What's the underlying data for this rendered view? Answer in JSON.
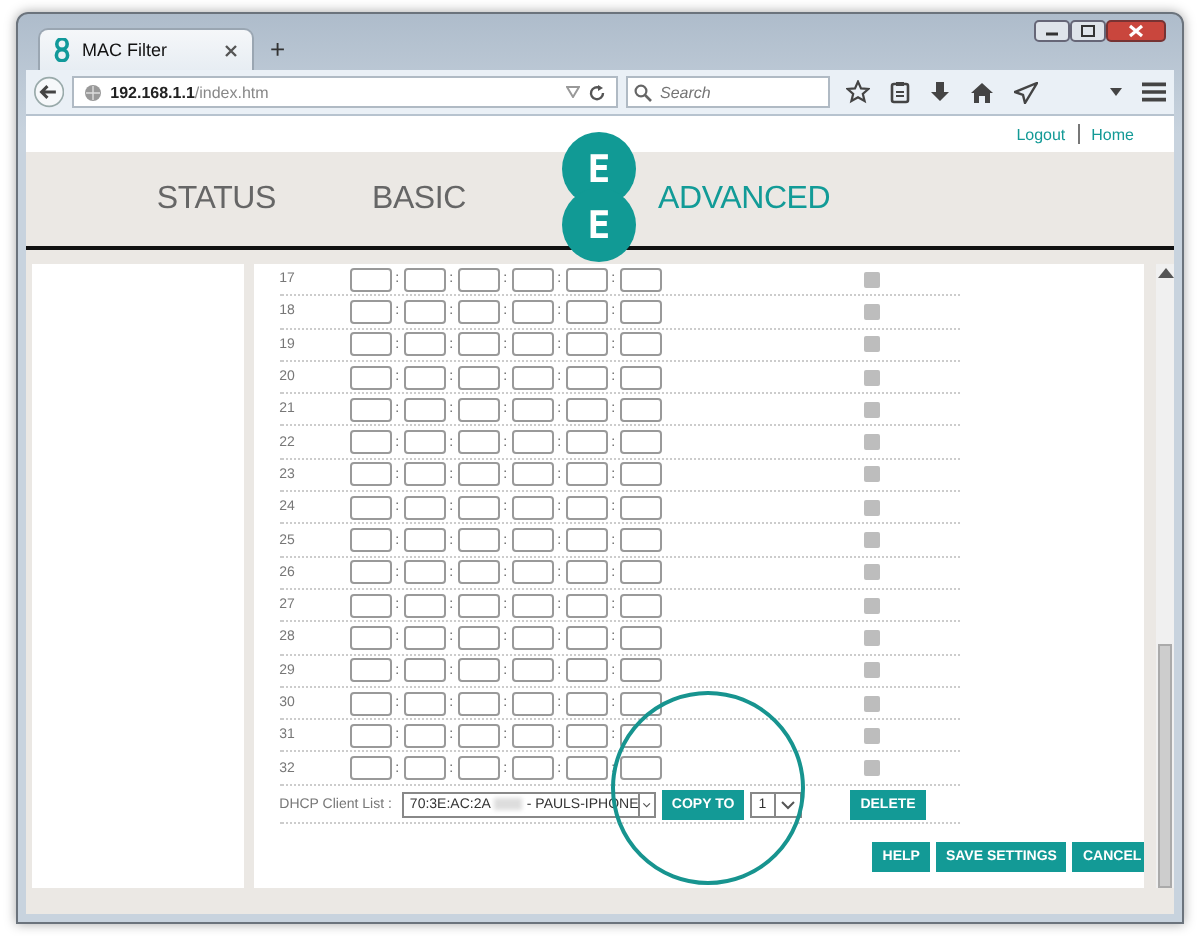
{
  "browser": {
    "tab_title": "MAC Filter",
    "new_tab": "+",
    "url_host": "192.168.1.1",
    "url_path": "/index.htm",
    "search_placeholder": "Search"
  },
  "top_links": [
    "Logout",
    "Home"
  ],
  "nav": [
    {
      "label": "STATUS",
      "selected": false
    },
    {
      "label": "BASIC",
      "selected": false
    },
    {
      "label": "ADVANCED",
      "selected": true
    }
  ],
  "logo": [
    "E",
    "E"
  ],
  "rows": [
    {
      "number": "17",
      "checked": false
    },
    {
      "number": "18",
      "checked": false
    },
    {
      "number": "19",
      "checked": false
    },
    {
      "number": "20",
      "checked": false
    },
    {
      "number": "21",
      "checked": false
    },
    {
      "number": "22",
      "checked": false
    },
    {
      "number": "23",
      "checked": false
    },
    {
      "number": "24",
      "checked": false
    },
    {
      "number": "25",
      "checked": false
    },
    {
      "number": "26",
      "checked": false
    },
    {
      "number": "27",
      "checked": false
    },
    {
      "number": "28",
      "checked": false
    },
    {
      "number": "29",
      "checked": false
    },
    {
      "number": "30",
      "checked": false
    },
    {
      "number": "31",
      "checked": false
    },
    {
      "number": "32",
      "checked": false
    }
  ],
  "separator": ":",
  "dhcp": {
    "label": "DHCP Client List :",
    "value_start": "70:3E:AC:2A",
    "value_end": "- PAULS-IPHONE",
    "copy_button": "COPY TO",
    "target": "1",
    "delete_button": "DELETE"
  },
  "buttons": [
    "HELP",
    "SAVE SETTINGS",
    "CANCEL"
  ]
}
